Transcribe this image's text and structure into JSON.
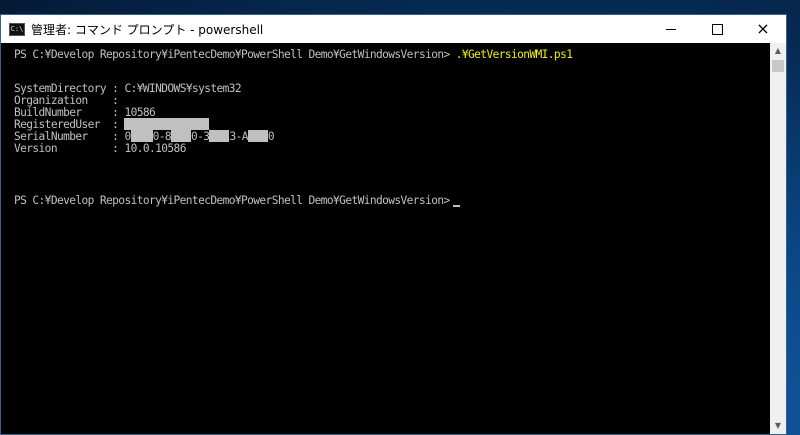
{
  "window": {
    "title": "管理者: コマンド プロンプト - powershell",
    "icon": "console-icon",
    "controls": {
      "minimize": "minimize-icon",
      "maximize": "maximize-icon",
      "close": "×"
    }
  },
  "console": {
    "prompt1": "PS C:¥Develop Repository¥iPentecDemo¥PowerShell Demo¥GetWindowsVersion> ",
    "command": ".¥GetVersionWMI.ps1",
    "rows": [
      {
        "label": "SystemDirectory",
        "sep": " : ",
        "value": "C:¥WINDOWS¥system32"
      },
      {
        "label": "Organization   ",
        "sep": " :",
        "value": ""
      },
      {
        "label": "BuildNumber    ",
        "sep": " : ",
        "value": "10586"
      },
      {
        "label": "RegisteredUser ",
        "sep": " : ",
        "value": ""
      },
      {
        "label": "SerialNumber   ",
        "sep": " : ",
        "value_parts": [
          "0",
          "0-8",
          "0-3",
          "3-A",
          "0"
        ]
      },
      {
        "label": "Version        ",
        "sep": " : ",
        "value": "10.0.10586"
      }
    ],
    "prompt2": "PS C:¥Develop Repository¥iPentecDemo¥PowerShell Demo¥GetWindowsVersion>"
  },
  "colors": {
    "console_bg": "#000000",
    "console_text": "#c0c0c0",
    "command_text": "#f0f000",
    "titlebar_bg": "#ffffff"
  }
}
